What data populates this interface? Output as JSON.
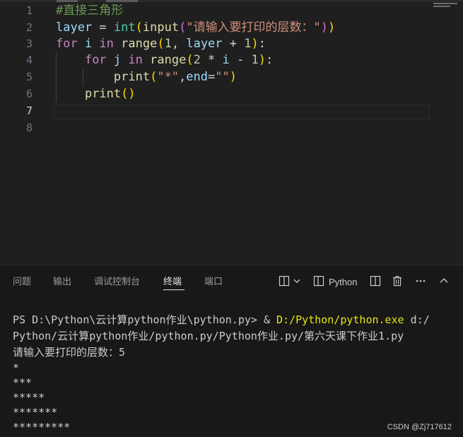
{
  "editor": {
    "line_numbers": [
      "1",
      "2",
      "3",
      "4",
      "5",
      "6",
      "7",
      "8"
    ],
    "active_line": "7",
    "code": {
      "l1_comment": "#直接三角形",
      "l2_var": "layer",
      "l2_eq": " = ",
      "l2_int": "int",
      "l2_open": "(",
      "l2_input": "input",
      "l2_open2": "(",
      "l2_str": "\"请输入要打印的层数：\"",
      "l2_close2": ")",
      "l2_close": ")",
      "l3_for": "for",
      "l3_i": " i ",
      "l3_in": "in",
      "l3_sp": " ",
      "l3_range": "range",
      "l3_open": "(",
      "l3_one": "1",
      "l3_comma": ", ",
      "l3_layer": "layer",
      "l3_plus": " + ",
      "l3_one2": "1",
      "l3_close": ")",
      "l3_colon": ":",
      "l4_indent": "    ",
      "l4_for": "for",
      "l4_j": " j ",
      "l4_in": "in",
      "l4_sp": " ",
      "l4_range": "range",
      "l4_open": "(",
      "l4_two": "2",
      "l4_mul": " * ",
      "l4_i": "i",
      "l4_minus": " - ",
      "l4_one": "1",
      "l4_close": ")",
      "l4_colon": ":",
      "l5_indent": "        ",
      "l5_print": "print",
      "l5_open": "(",
      "l5_star": "\"*\"",
      "l5_comma": ",",
      "l5_end": "end",
      "l5_eq": "=",
      "l5_empty": "\"\"",
      "l5_close": ")",
      "l6_indent": "    ",
      "l6_print": "print",
      "l6_parens": "()"
    }
  },
  "panel": {
    "tabs": [
      "问题",
      "输出",
      "调试控制台",
      "终端",
      "端口"
    ],
    "active_tab": "终端",
    "python_label": "Python",
    "icons": [
      "split-terminal-icon",
      "chevron-down-icon",
      "terminal-icon",
      "split-layout-icon",
      "trash-icon",
      "more-icon",
      "chevron-up-icon"
    ]
  },
  "terminal": {
    "prompt": "PS D:\\Python\\云计算python作业\\python.py> & ",
    "exe_path": "D:/Python/python.exe",
    "arg_start": " d:/",
    "arg_cont": "Python/云计算python作业/python.py/Python作业.py/第六天课下作业1.py",
    "input_prompt": "请输入要打印的层数：5",
    "output": [
      "*",
      "***",
      "*****",
      "*******",
      "*********"
    ]
  },
  "watermark": "CSDN @Zj717612",
  "colors": {
    "editor_bg": "#1f1f1f",
    "panel_bg": "#181818",
    "keyword": "#c586c0",
    "function": "#dcdcaa",
    "string": "#ce9178",
    "comment": "#6a9955",
    "variable": "#9cdcfe",
    "number": "#b5cea8",
    "path_highlight": "#e5e510"
  }
}
